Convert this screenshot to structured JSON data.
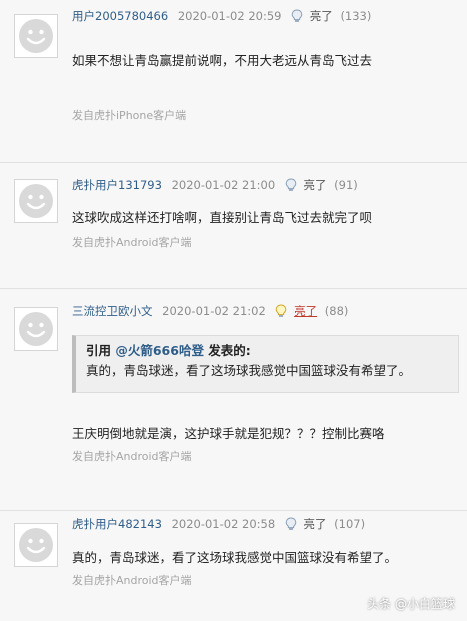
{
  "posts": [
    {
      "user": "用户2005780466",
      "time": "2020-01-02 20:59",
      "lights_label": "亮了",
      "lights_count": "(133)",
      "content": "如果不想让青岛赢提前说啊，不用大老远从青岛飞过去",
      "source": "发自虎扑iPhone客户端"
    },
    {
      "user": "虎扑用户131793",
      "time": "2020-01-02 21:00",
      "lights_label": "亮了",
      "lights_count": "(91)",
      "content": "这球吹成这样还打啥啊，直接别让青岛飞过去就完了呗",
      "source": "发自虎扑Android客户端"
    },
    {
      "user": "三流控卫欧小文",
      "time": "2020-01-02 21:02",
      "lights_label": "亮了",
      "lights_count": "(88)",
      "quote": {
        "prefix": "引用 ",
        "user": "@火箭666哈登",
        "suffix": " 发表的:",
        "text": "真的，青岛球迷，看了这场球我感觉中国篮球没有希望了。"
      },
      "content": "王庆明倒地就是演，这护球手就是犯规？？？控制比赛咯",
      "source": "发自虎扑Android客户端"
    },
    {
      "user": "虎扑用户482143",
      "time": "2020-01-02 20:58",
      "lights_label": "亮了",
      "lights_count": "(107)",
      "content": "真的，青岛球迷，看了这场球我感觉中国篮球没有希望了。",
      "source": "发自虎扑Android客户端"
    }
  ],
  "watermark": "头条 @小白篮球",
  "icons": {
    "avatar": "default-avatar-icon",
    "light": "lightbulb-icon"
  }
}
